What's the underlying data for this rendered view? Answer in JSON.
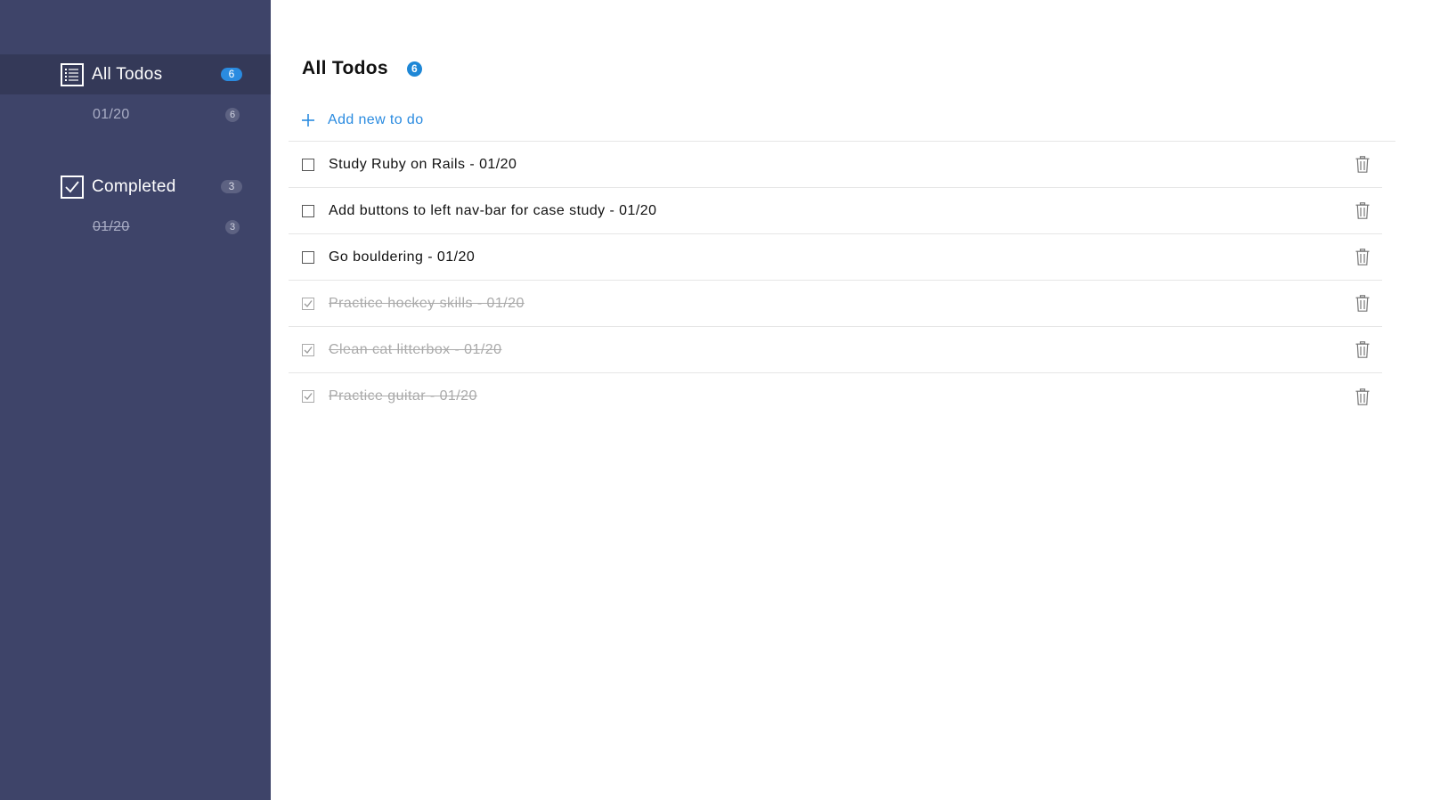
{
  "sidebar": {
    "all_todos": {
      "label": "All Todos",
      "count": "6",
      "icon": "list-icon"
    },
    "all_todos_sub": [
      {
        "label": "01/20",
        "count": "6"
      }
    ],
    "completed": {
      "label": "Completed",
      "count": "3",
      "icon": "checkbox-icon"
    },
    "completed_sub": [
      {
        "label": "01/20",
        "count": "3"
      }
    ]
  },
  "main": {
    "title": "All Todos",
    "count": "6",
    "add_label": "Add new to do",
    "todos": [
      {
        "text": "Study Ruby on Rails - 01/20",
        "done": false
      },
      {
        "text": "Add buttons to left nav-bar for case study - 01/20",
        "done": false
      },
      {
        "text": "Go bouldering - 01/20",
        "done": false
      },
      {
        "text": "Practice hockey skills - 01/20",
        "done": true
      },
      {
        "text": "Clean cat litterbox - 01/20",
        "done": true
      },
      {
        "text": "Practice guitar - 01/20",
        "done": true
      }
    ]
  },
  "colors": {
    "sidebar_bg": "#3e4469",
    "sidebar_active": "#343958",
    "accent": "#2a8be0",
    "done_text": "#aaaaaa"
  }
}
